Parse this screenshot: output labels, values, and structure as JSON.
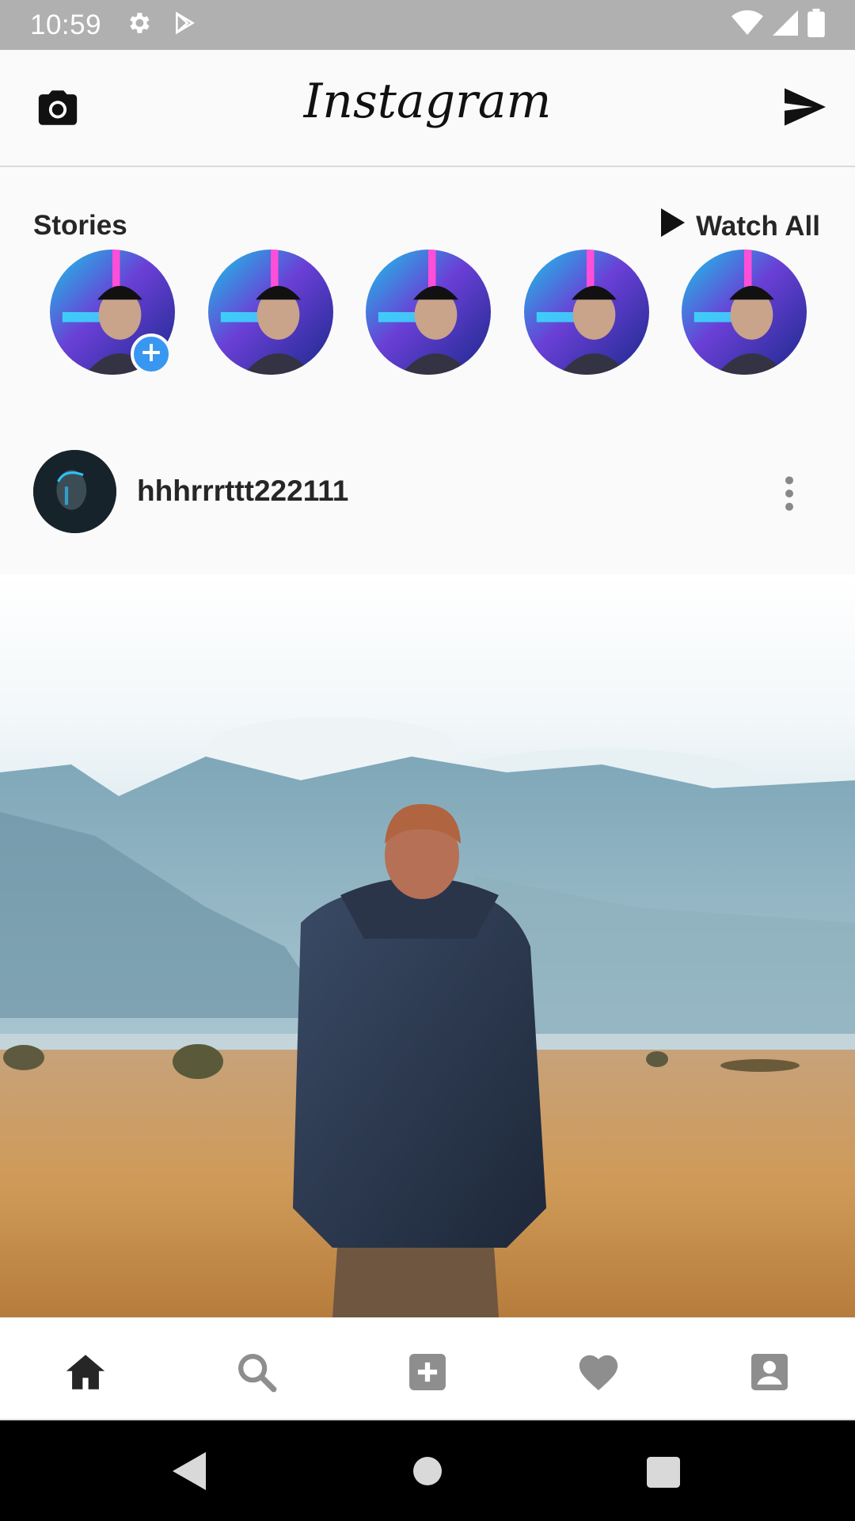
{
  "status_bar": {
    "time": "10:59",
    "left_icons": [
      "gear-icon",
      "play-store-icon"
    ],
    "right_icons": [
      "wifi-icon",
      "signal-icon",
      "battery-icon"
    ]
  },
  "header": {
    "title": "Instagram",
    "left_icon": "camera-icon",
    "right_icon": "send-icon"
  },
  "stories": {
    "title": "Stories",
    "watch_all_label": "Watch All",
    "watch_all_icon": "play-icon",
    "count": 5,
    "first_has_add_badge": true
  },
  "post": {
    "username": "hhhrrrttt222111",
    "more_icon": "more-vertical-icon"
  },
  "bottom_nav": {
    "items": [
      "home-icon",
      "search-icon",
      "add-box-icon",
      "heart-icon",
      "account-box-icon"
    ],
    "active": "home-icon"
  },
  "system_nav": {
    "items": [
      "back-icon",
      "home-circle-icon",
      "recents-icon"
    ]
  },
  "colors": {
    "accent": "#3897f0",
    "text": "#262626",
    "status_bar": "#b0b0b0",
    "nav_inactive": "#8e8e8e"
  }
}
